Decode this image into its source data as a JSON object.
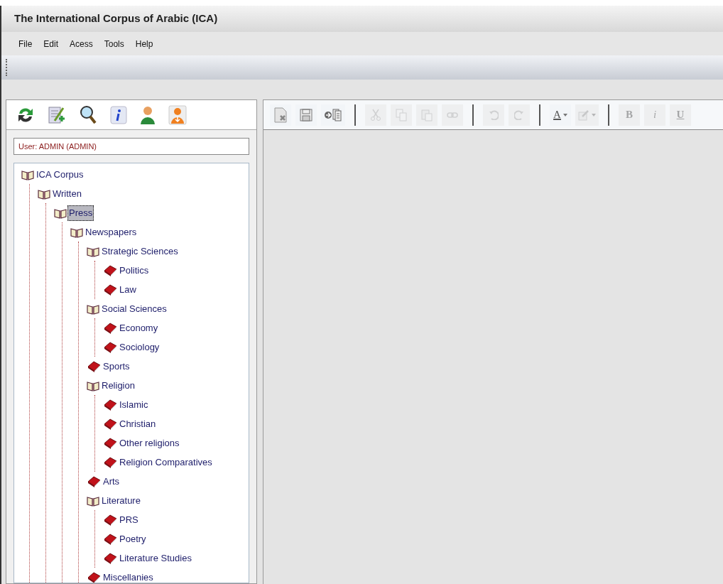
{
  "window": {
    "title": "The International Corpus of Arabic (ICA)"
  },
  "menu": [
    "File",
    "Edit",
    "Acess",
    "Tools",
    "Help"
  ],
  "user_field": {
    "value": "User: ADMIN (ADMIN)"
  },
  "editor_toolbar": [
    {
      "kind": "delete-doc",
      "disabled": false
    },
    {
      "kind": "save",
      "disabled": false
    },
    {
      "kind": "export",
      "disabled": false
    },
    {
      "kind": "sep"
    },
    {
      "kind": "cut",
      "disabled": true
    },
    {
      "kind": "copy",
      "disabled": true
    },
    {
      "kind": "paste",
      "disabled": true
    },
    {
      "kind": "link",
      "disabled": true
    },
    {
      "kind": "sep"
    },
    {
      "kind": "undo",
      "disabled": true
    },
    {
      "kind": "redo",
      "disabled": true
    },
    {
      "kind": "sep"
    },
    {
      "kind": "font-color",
      "label": "A",
      "disabled": false
    },
    {
      "kind": "highlight",
      "disabled": true
    },
    {
      "kind": "sep"
    },
    {
      "kind": "bold",
      "label": "B",
      "disabled": true
    },
    {
      "kind": "italic",
      "label": "i",
      "disabled": true
    },
    {
      "kind": "underline",
      "label": "U",
      "disabled": true
    }
  ],
  "tree": [
    {
      "label": "ICA Corpus",
      "kind": "folder",
      "selected": false,
      "children": [
        {
          "label": "Written",
          "kind": "folder",
          "selected": false,
          "children": [
            {
              "label": "Press",
              "kind": "folder",
              "selected": true,
              "children": [
                {
                  "label": "Newspapers",
                  "kind": "folder",
                  "selected": false,
                  "children": [
                    {
                      "label": "Strategic Sciences",
                      "kind": "folder",
                      "selected": false,
                      "children": [
                        {
                          "label": "Politics",
                          "kind": "book",
                          "selected": false
                        },
                        {
                          "label": "Law",
                          "kind": "book",
                          "selected": false
                        }
                      ]
                    },
                    {
                      "label": "Social Sciences",
                      "kind": "folder",
                      "selected": false,
                      "children": [
                        {
                          "label": "Economy",
                          "kind": "book",
                          "selected": false
                        },
                        {
                          "label": "Sociology",
                          "kind": "book",
                          "selected": false
                        }
                      ]
                    },
                    {
                      "label": "Sports",
                      "kind": "book",
                      "selected": false
                    },
                    {
                      "label": "Religion",
                      "kind": "folder",
                      "selected": false,
                      "children": [
                        {
                          "label": "Islamic",
                          "kind": "book",
                          "selected": false
                        },
                        {
                          "label": "Christian",
                          "kind": "book",
                          "selected": false
                        },
                        {
                          "label": "Other religions",
                          "kind": "book",
                          "selected": false
                        },
                        {
                          "label": "Religion Comparatives",
                          "kind": "book",
                          "selected": false
                        }
                      ]
                    },
                    {
                      "label": "Arts",
                      "kind": "book",
                      "selected": false
                    },
                    {
                      "label": "Literature",
                      "kind": "folder",
                      "selected": false,
                      "children": [
                        {
                          "label": "PRS",
                          "kind": "book",
                          "selected": false
                        },
                        {
                          "label": "Poetry",
                          "kind": "book",
                          "selected": false
                        },
                        {
                          "label": "Literature Studies",
                          "kind": "book",
                          "selected": false
                        }
                      ]
                    },
                    {
                      "label": "Miscellanies",
                      "kind": "book",
                      "selected": false
                    }
                  ]
                }
              ]
            }
          ]
        }
      ]
    }
  ]
}
